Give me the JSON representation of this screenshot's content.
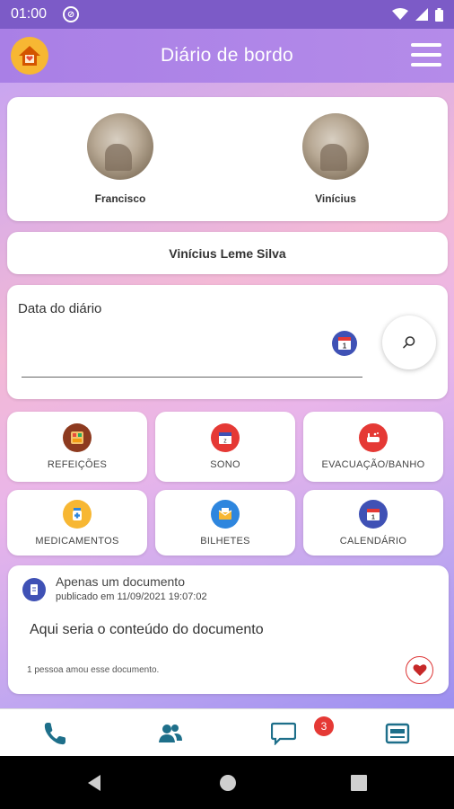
{
  "status_bar": {
    "time": "01:00"
  },
  "app_bar": {
    "title": "Diário de bordo"
  },
  "children": [
    {
      "name": "Francisco"
    },
    {
      "name": "Vinícius"
    }
  ],
  "selected_child": "Vinícius Leme Silva",
  "diary": {
    "label": "Data do diário",
    "date_value": ""
  },
  "menu_tiles": [
    {
      "label": "REFEIÇÕES",
      "icon": "meal-icon",
      "color": "#8d3a1f"
    },
    {
      "label": "SONO",
      "icon": "sleep-calendar-icon",
      "color": "#e53935"
    },
    {
      "label": "EVACUAÇÃO/BANHO",
      "icon": "bathtub-icon",
      "color": "#e53935"
    },
    {
      "label": "MEDICAMENTOS",
      "icon": "medicine-icon",
      "color": "#f7b733"
    },
    {
      "label": "BILHETES",
      "icon": "note-icon",
      "color": "#2e86de"
    },
    {
      "label": "CALENDÁRIO",
      "icon": "calendar-icon",
      "color": "#3f51b5"
    }
  ],
  "document": {
    "title": "Apenas um documento",
    "published": "publicado em 11/09/2021 19:07:02",
    "body": "Aqui seria o conteúdo do documento",
    "likes": "1 pessoa amou esse documento."
  },
  "bottom_nav": {
    "items": [
      "phone-icon",
      "contacts-icon",
      "chat-icon",
      "bulletin-icon"
    ],
    "chat_badge": "3"
  },
  "colors": {
    "primary": "#a97fe6",
    "status_bar": "#7c5bc7",
    "nav_icon": "#1e6f8a",
    "badge": "#e53935"
  }
}
